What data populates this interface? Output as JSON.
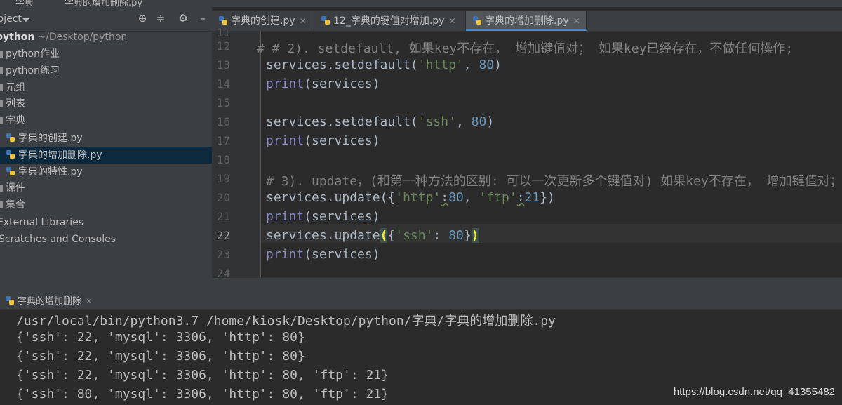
{
  "breadcrumb": {
    "folder": "字典",
    "file": "字典的增加删除.py"
  },
  "project_panel": {
    "title": "Project",
    "root_name": "python",
    "root_path": "~/Desktop/python",
    "items": [
      {
        "label": "python作业",
        "kind": "folder"
      },
      {
        "label": "python练习",
        "kind": "folder"
      },
      {
        "label": "元组",
        "kind": "folder"
      },
      {
        "label": "列表",
        "kind": "folder"
      },
      {
        "label": "字典",
        "kind": "folder"
      },
      {
        "label": "字典的创建.py",
        "kind": "file"
      },
      {
        "label": "字典的增加删除.py",
        "kind": "file",
        "selected": true
      },
      {
        "label": "字典的特性.py",
        "kind": "file"
      },
      {
        "label": "课件",
        "kind": "folder"
      },
      {
        "label": "集合",
        "kind": "folder"
      }
    ],
    "external_libraries": "External Libraries",
    "scratches": "Scratches and Consoles"
  },
  "editor_tabs": [
    {
      "label": "字典的创建.py"
    },
    {
      "label": "12_字典的键值对增加.py"
    },
    {
      "label": "字典的增加删除.py",
      "active": true
    }
  ],
  "code": {
    "current_line": 22,
    "line_numbers": [
      "11",
      "12",
      "13",
      "14",
      "15",
      "16",
      "17",
      "18",
      "19",
      "20",
      "21",
      "22",
      "23",
      "24"
    ],
    "line12_comment": "# # 2). setdefault, 如果key不存在， 增加键值对； 如果key已经存在，不做任何操作;",
    "line13": {
      "obj": "services.setdefault(",
      "str": "'http'",
      "sep": ", ",
      "num": "80",
      "end": ")"
    },
    "line14": {
      "fn": "print",
      "arg": "(services)"
    },
    "line16": {
      "obj": "services.setdefault(",
      "str": "'ssh'",
      "sep": ", ",
      "num": "80",
      "end": ")"
    },
    "line17": {
      "fn": "print",
      "arg": "(services)"
    },
    "line19_comment": "# 3). update，(和第一种方法的区别: 可以一次更新多个键值对) 如果key不存在， 增加键值对；",
    "line20": {
      "pre": "services.update({",
      "s1": "'http'",
      "c1": ":",
      "n1": "80",
      "sep": ", ",
      "s2": "'ftp'",
      "c2": ":",
      "n2": "21",
      "end": "})"
    },
    "line21": {
      "fn": "print",
      "arg": "(services)"
    },
    "line22": {
      "pre": "services.update",
      "open": "(",
      "mid": "{",
      "s1": "'ssh'",
      "c1": ": ",
      "n1": "80",
      "close_brace": "}",
      "close": ")"
    },
    "line23": {
      "fn": "print",
      "arg": "(services)"
    }
  },
  "run_panel": {
    "tab_label": "字典的增加删除",
    "output": [
      "/usr/local/bin/python3.7 /home/kiosk/Desktop/python/字典/字典的增加删除.py",
      "{'ssh': 22, 'mysql': 3306, 'http': 80}",
      "{'ssh': 22, 'mysql': 3306, 'http': 80}",
      "{'ssh': 22, 'mysql': 3306, 'http': 80, 'ftp': 21}",
      "{'ssh': 80, 'mysql': 3306, 'http': 80, 'ftp': 21}"
    ]
  },
  "watermark": "https://blog.csdn.net/qq_41355482",
  "icons": {
    "target": "crosshair-icon",
    "collapse": "collapse-icon",
    "settings": "gear-icon",
    "hide": "minus-icon"
  },
  "colors": {
    "selection": "#0d293e",
    "accent": "#4a88c7",
    "string": "#6a8759",
    "number": "#6897bb",
    "comment": "#808080"
  }
}
